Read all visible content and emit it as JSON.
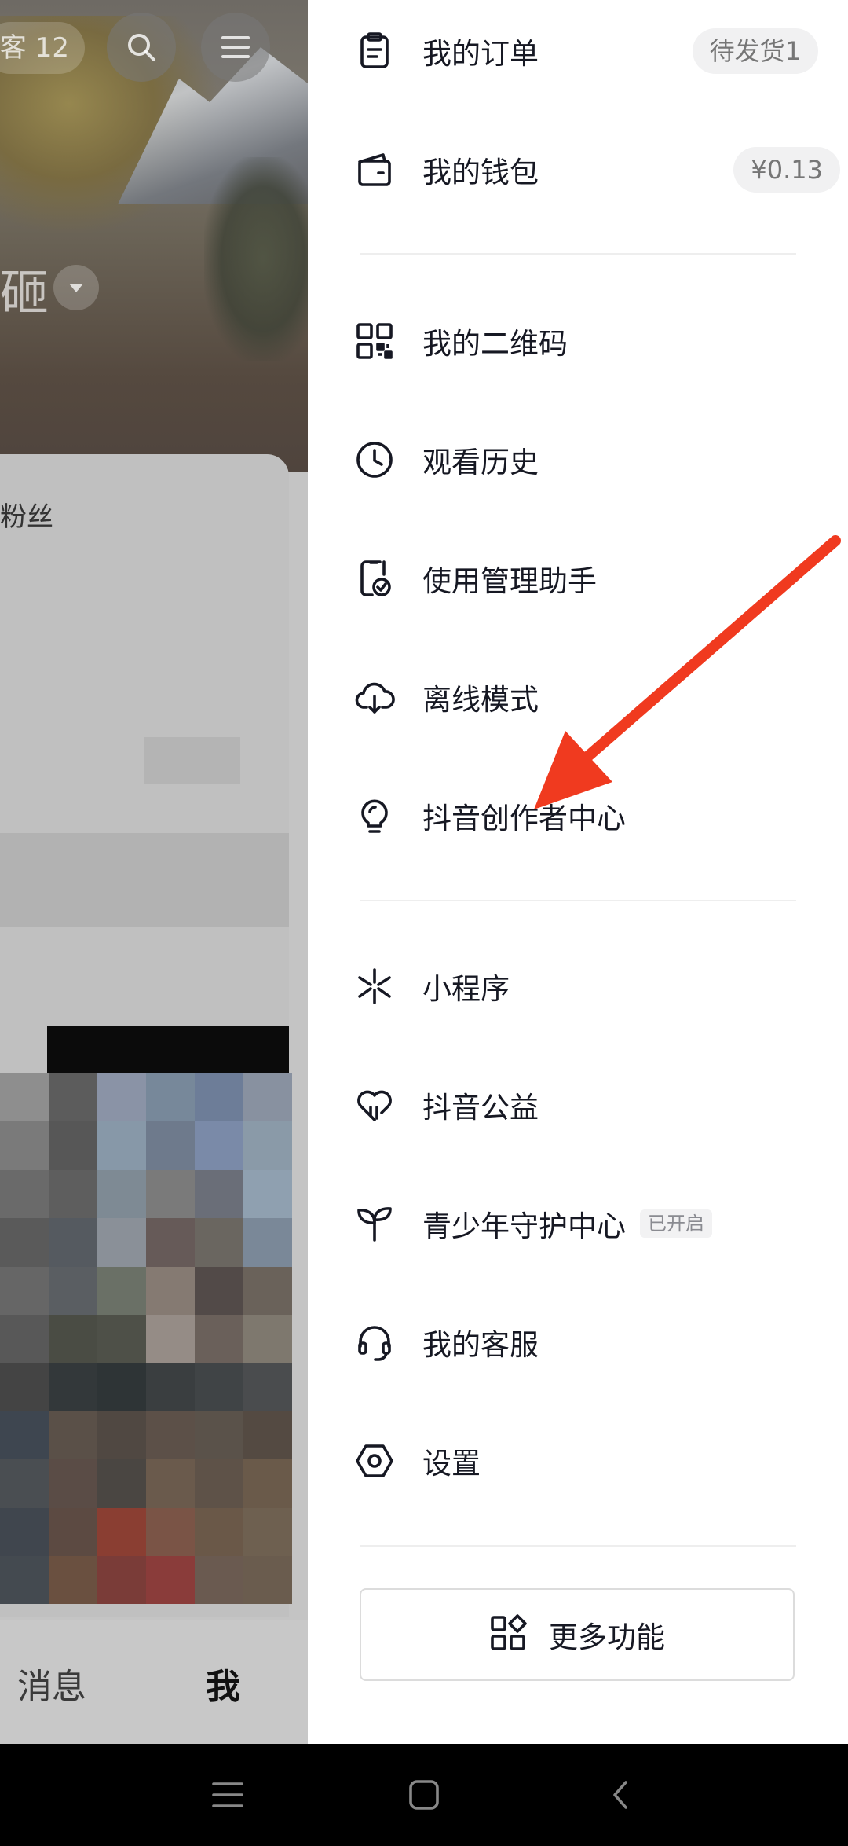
{
  "background": {
    "top_pill_text": "客 12",
    "name_fragment": "砸",
    "fans_label": "粉丝",
    "tabs": {
      "messages": "消息",
      "me": "我"
    }
  },
  "drawer": {
    "items": [
      {
        "label": "我的订单",
        "icon": "clipboard-icon",
        "badge": "待发货1"
      },
      {
        "label": "我的钱包",
        "icon": "wallet-icon",
        "badge": "¥0.13"
      },
      {
        "label": "我的二维码",
        "icon": "qr-code-icon"
      },
      {
        "label": "观看历史",
        "icon": "clock-icon"
      },
      {
        "label": "使用管理助手",
        "icon": "phone-check-icon"
      },
      {
        "label": "离线模式",
        "icon": "cloud-download-icon"
      },
      {
        "label": "抖音创作者中心",
        "icon": "lightbulb-icon"
      },
      {
        "label": "小程序",
        "icon": "mini-program-icon"
      },
      {
        "label": "抖音公益",
        "icon": "heart-charity-icon"
      },
      {
        "label": "青少年守护中心",
        "icon": "sprout-icon",
        "tag": "已开启"
      },
      {
        "label": "我的客服",
        "icon": "headset-icon"
      },
      {
        "label": "设置",
        "icon": "settings-hexagon-icon"
      }
    ],
    "more_button": {
      "label": "更多功能",
      "icon": "grid-apps-icon"
    }
  },
  "system_nav": {
    "icons": [
      "menu-icon",
      "home-icon",
      "back-icon"
    ]
  },
  "colors": {
    "annotation_arrow": "#f03a1f",
    "text": "#161823",
    "badge_bg": "#f1f1f2"
  }
}
